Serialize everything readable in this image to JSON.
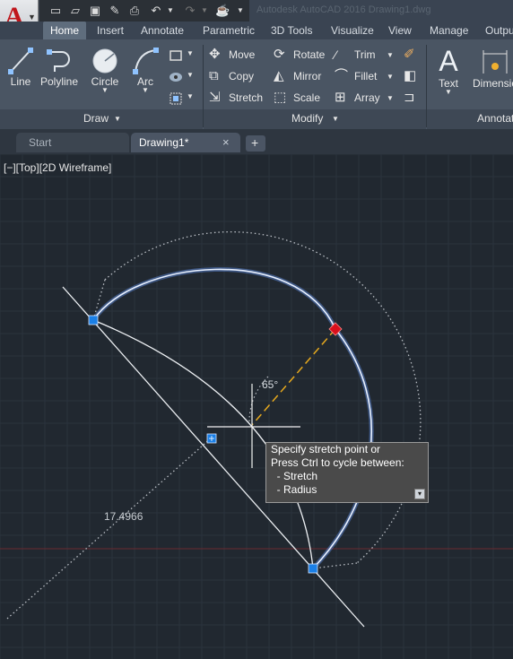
{
  "app": {
    "logo_letter": "A",
    "window_title": "Autodesk AutoCAD 2016   Drawing1.dwg"
  },
  "ribbon_tabs": [
    "Home",
    "Insert",
    "Annotate",
    "Parametric",
    "3D Tools",
    "Visualize",
    "View",
    "Manage",
    "Outpu"
  ],
  "panels": {
    "draw": {
      "title": "Draw",
      "tools": [
        "Line",
        "Polyline",
        "Circle",
        "Arc"
      ]
    },
    "modify": {
      "title": "Modify",
      "tools": [
        "Move",
        "Rotate",
        "Trim",
        "Copy",
        "Mirror",
        "Fillet",
        "Stretch",
        "Scale",
        "Array"
      ]
    },
    "annotation": {
      "title": "Annotat",
      "tools": [
        "Text",
        "Dimensio"
      ]
    }
  },
  "doc_tabs": {
    "start": "Start",
    "drawing": "Drawing1*",
    "close": "×",
    "new": "+"
  },
  "viewport": {
    "label": "[−][Top][2D Wireframe]"
  },
  "dimensions": {
    "angle": "65°",
    "radius_value": "17.4966"
  },
  "tooltip": {
    "lines": [
      "Specify stretch point or",
      "Press Ctrl to cycle between:",
      "  - Stretch",
      "  - Radius"
    ]
  },
  "colors": {
    "canvas_bg": "#212830",
    "grid_line": "#2b333d",
    "arc_highlight": "#7fb0ff",
    "grip": "#1a7fe6",
    "hot_grip": "#d9101c",
    "dash_line": "#e6a91e",
    "axis_red": "#7a2a30"
  }
}
